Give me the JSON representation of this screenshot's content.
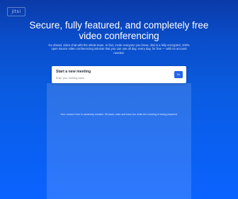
{
  "logo": {
    "text": "jitsi"
  },
  "header": {
    "headline": "Secure, fully featured, and completely free video conferencing",
    "intro": "Go ahead, video chat with the whole team. In fact, invite everyone you know. Jitsi is a fully encrypted, 100% open source video conferencing solution that you can use all day, every day, for free — with no account needed."
  },
  "meeting_card": {
    "title": "Start a new meeting",
    "input_placeholder": "Enter your meeting name",
    "go_button_label": "Go"
  },
  "welcome_panel": {
    "text": "Your content here is randomly created. Sit back, relax and have fun while the meeting is being prepared."
  }
}
